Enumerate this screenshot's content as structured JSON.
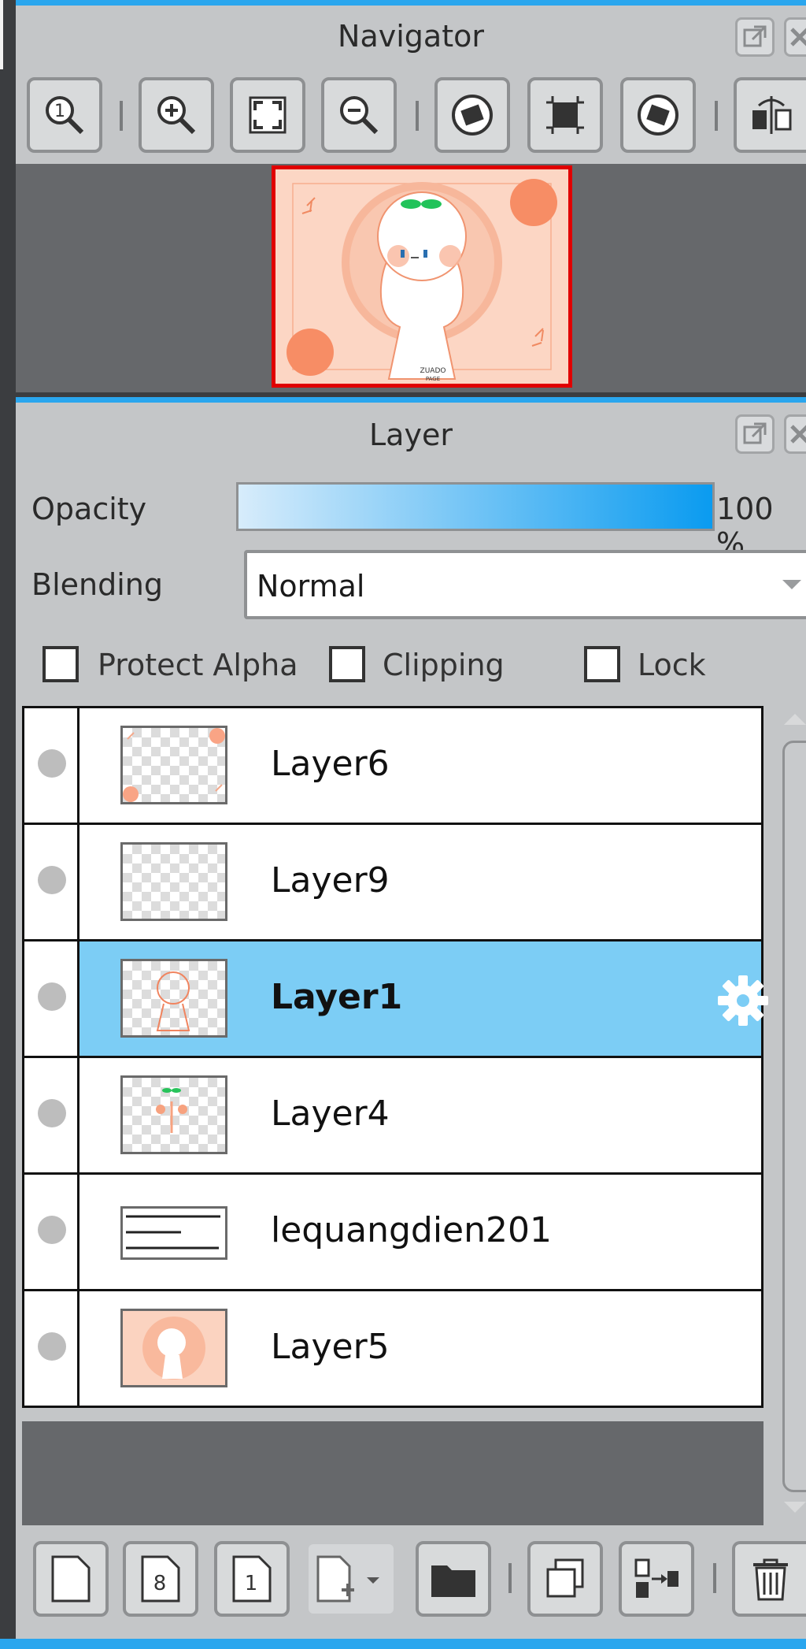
{
  "navigator": {
    "title": "Navigator",
    "toolbar": [
      {
        "icon": "zoom-actual-icon"
      },
      {
        "icon": "zoom-in-icon"
      },
      {
        "icon": "fit-to-window-icon"
      },
      {
        "icon": "zoom-out-icon"
      },
      {
        "icon": "rotate-left-icon"
      },
      {
        "icon": "reset-view-icon"
      },
      {
        "icon": "rotate-right-icon"
      },
      {
        "icon": "flip-horizontal-icon"
      }
    ],
    "preview_text": "ZUADO\nPAGE",
    "viewport_border_color": "#e00000"
  },
  "layer_panel": {
    "title": "Layer",
    "opacity_label": "Opacity",
    "opacity_value": "100 %",
    "opacity_percent": 100,
    "blending_label": "Blending",
    "blending_value": "Normal",
    "checkboxes": {
      "protect_alpha": {
        "label": "Protect Alpha",
        "checked": false
      },
      "clipping": {
        "label": "Clipping",
        "checked": false
      },
      "lock": {
        "label": "Lock",
        "checked": false
      }
    },
    "layers": [
      {
        "name": "Layer6",
        "selected": false
      },
      {
        "name": "Layer9",
        "selected": false
      },
      {
        "name": "Layer1",
        "selected": true
      },
      {
        "name": "Layer4",
        "selected": false
      },
      {
        "name": "lequangdien201",
        "selected": false
      },
      {
        "name": "Layer5",
        "selected": false
      }
    ],
    "bottom_toolbar": [
      {
        "icon": "new-layer-icon"
      },
      {
        "icon": "new-8bit-layer-icon",
        "text": "8"
      },
      {
        "icon": "new-1bit-layer-icon",
        "text": "1"
      },
      {
        "icon": "add-layer-menu-icon"
      },
      {
        "icon": "new-folder-icon"
      },
      {
        "icon": "duplicate-layer-icon"
      },
      {
        "icon": "merge-down-icon"
      },
      {
        "icon": "delete-layer-icon"
      }
    ],
    "accent_color": "#2aa6ee",
    "selected_row_color": "#7ccdf5"
  }
}
